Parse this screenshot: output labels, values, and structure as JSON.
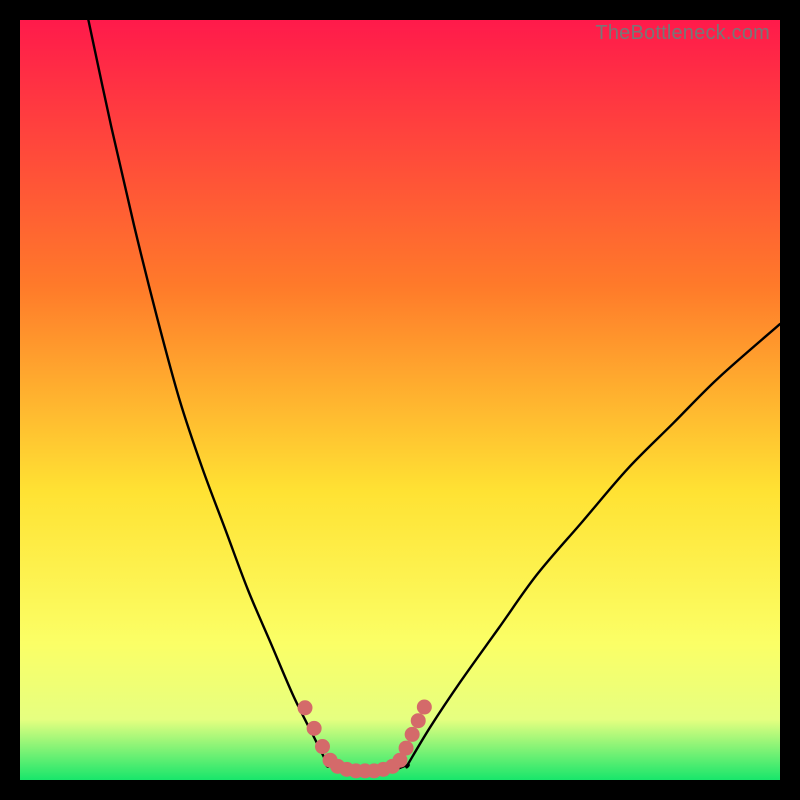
{
  "watermark": "TheBottleneck.com",
  "colors": {
    "bg": "#000000",
    "gradient_top": "#ff1a4b",
    "gradient_mid1": "#ff7a2a",
    "gradient_mid2": "#ffe233",
    "gradient_mid3": "#fbff66",
    "gradient_band": "#e6ff80",
    "gradient_bottom": "#18e66b",
    "curve": "#000000",
    "marker": "#d46a6a"
  },
  "chart_data": {
    "type": "line",
    "title": "",
    "xlabel": "",
    "ylabel": "",
    "xlim": [
      0,
      100
    ],
    "ylim": [
      0,
      100
    ],
    "series": [
      {
        "name": "left-branch",
        "x": [
          9,
          12,
          15,
          18,
          21,
          24,
          27,
          30,
          33,
          36,
          38.5,
          40.5
        ],
        "y": [
          100,
          86,
          73,
          61,
          50,
          41,
          33,
          25,
          18,
          11,
          6,
          2
        ]
      },
      {
        "name": "floor",
        "x": [
          40.5,
          44,
          48,
          51
        ],
        "y": [
          2,
          1,
          1,
          2
        ]
      },
      {
        "name": "right-branch",
        "x": [
          51,
          54,
          58,
          63,
          68,
          74,
          80,
          86,
          92,
          100
        ],
        "y": [
          2,
          7,
          13,
          20,
          27,
          34,
          41,
          47,
          53,
          60
        ]
      }
    ],
    "markers": {
      "name": "highlight-segment",
      "x": [
        37.5,
        38.7,
        39.8,
        40.8,
        41.8,
        43.0,
        44.2,
        45.4,
        46.6,
        47.8,
        49.0,
        50.0,
        50.8,
        51.6,
        52.4,
        53.2
      ],
      "y": [
        9.5,
        6.8,
        4.4,
        2.6,
        1.8,
        1.4,
        1.2,
        1.2,
        1.2,
        1.4,
        1.8,
        2.6,
        4.2,
        6.0,
        7.8,
        9.6
      ]
    }
  }
}
